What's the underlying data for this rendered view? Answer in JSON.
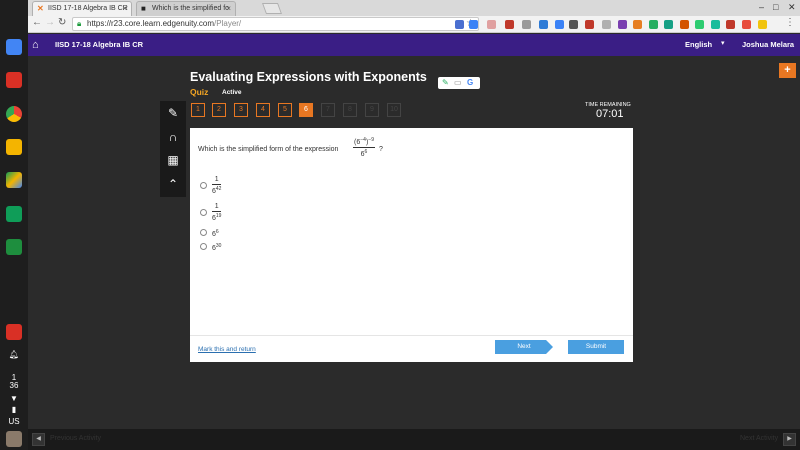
{
  "browser": {
    "tabs": [
      {
        "title": "IISD 17-18 Algebra IB CR",
        "icon": "edgenuity-x-icon"
      },
      {
        "title": "Which is the simplified fo",
        "icon": "brainly-icon"
      }
    ],
    "url_host": "https://r23.core.learn.edgenuity.com",
    "url_path": "/Player/"
  },
  "os": {
    "tray_count_top": "1",
    "tray_count_bottom": "36",
    "locale": "US"
  },
  "appbar": {
    "course": "IISD 17-18 Algebra IB CR",
    "language": "English",
    "user": "Joshua Melara"
  },
  "lesson": {
    "title": "Evaluating Expressions with Exponents",
    "type": "Quiz",
    "status": "Active"
  },
  "question_nav": {
    "items": [
      "1",
      "2",
      "3",
      "4",
      "5",
      "6",
      "7",
      "8",
      "9",
      "10"
    ],
    "current": "6"
  },
  "timer": {
    "label": "TIME REMAINING",
    "value": "07:01"
  },
  "question": {
    "prompt": "Which is the simplified form of the expression",
    "expr_num_base": "(6",
    "expr_num_inner_exp": "−4",
    "expr_num_close": ")",
    "expr_num_outer_exp": "−9",
    "expr_den_base": "6",
    "expr_den_exp": "6",
    "end": "?"
  },
  "options": [
    {
      "num": "1",
      "den_base": "6",
      "den_exp": "42"
    },
    {
      "num": "1",
      "den_base": "6",
      "den_exp": "19"
    },
    {
      "base": "6",
      "exp": "6"
    },
    {
      "base": "6",
      "exp": "30"
    }
  ],
  "footer": {
    "mark_link": "Mark this and return",
    "next_label": "Next",
    "submit_label": "Submit"
  },
  "bottombar": {
    "prev_activity": "Previous Activity",
    "next_activity": "Next Activity"
  },
  "colors": {
    "appbar": "#3a1e85",
    "accent": "#e87722",
    "button": "#4a9fe0"
  }
}
